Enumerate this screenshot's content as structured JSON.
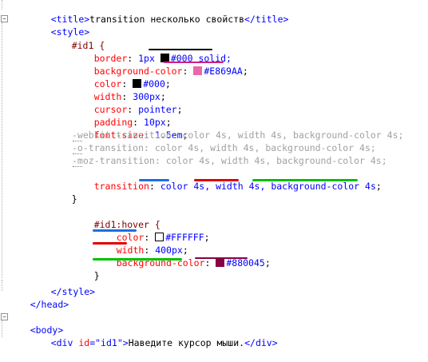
{
  "code": {
    "title_line": {
      "open": "<title>",
      "text": "transition несколько свойств",
      "close": "</title>"
    },
    "style_open": "<style>",
    "id1_selector": "#id1 {",
    "id1_props": [
      {
        "name": "border",
        "sep": ": ",
        "pre": "1px ",
        "swatch": "#000000",
        "value": "#000",
        "post": " solid;"
      },
      {
        "name": "background-color",
        "sep": ": ",
        "pre": "",
        "swatch": "#E869AA",
        "value": "#E869AA",
        "post": ";"
      },
      {
        "name": "color",
        "sep": ": ",
        "pre": "",
        "swatch": "#000000",
        "value": "#000",
        "post": ";"
      },
      {
        "name": "width",
        "sep": ": ",
        "pre": "",
        "swatch": "",
        "value": "300px",
        "post": ";"
      },
      {
        "name": "cursor",
        "sep": ": ",
        "pre": "",
        "swatch": "",
        "value": "pointer",
        "post": ";"
      },
      {
        "name": "padding",
        "sep": ": ",
        "pre": "",
        "swatch": "",
        "value": "10px",
        "post": ";"
      },
      {
        "name": "font-size",
        "sep": ": ",
        "pre": "",
        "swatch": "",
        "value": "1.5em",
        "post": ";"
      }
    ],
    "vendor_lines": [
      "-webkit-transition: color 4s, width 4s, background-color 4s;",
      "-o-transition: color 4s, width 4s, background-color 4s;",
      "-moz-transition: color 4s, width 4s, background-color 4s;"
    ],
    "transition": {
      "name": "transition",
      "sep": ": ",
      "v1": "color",
      "t1": " 4s, ",
      "v2": "width",
      "t2": " 4s, ",
      "v3": "background-color",
      "t3": " 4s",
      "end": ";"
    },
    "close_brace": "}",
    "hover_selector": "#id1:hover {",
    "hover_props": [
      {
        "name": "color",
        "sep": ": ",
        "swatch": "#FFFFFF",
        "value": "#FFFFFF",
        "post": ";"
      },
      {
        "name": "width",
        "sep": ": ",
        "swatch": "",
        "value": "400px",
        "post": ";"
      },
      {
        "name": "background-color",
        "sep": ": ",
        "swatch": "#880045",
        "value": "#880045",
        "post": ";"
      }
    ],
    "hover_close": "}",
    "style_close": "</style>",
    "head_close": "</head>",
    "body_open": "<body>",
    "div_line": {
      "open": "<div ",
      "attr": "id",
      "eq": "=",
      "attrval": "\"id1\"",
      "gt": ">",
      "text": "Наведите курсор мыши.",
      "close": "</div>"
    }
  },
  "colors": {
    "blue_underline": "#1e6ee0",
    "red_underline": "#e00000",
    "green_underline": "#00c000",
    "black_underline": "#000000",
    "pink_underline": "#d02080",
    "maroon_underline": "#880045"
  }
}
